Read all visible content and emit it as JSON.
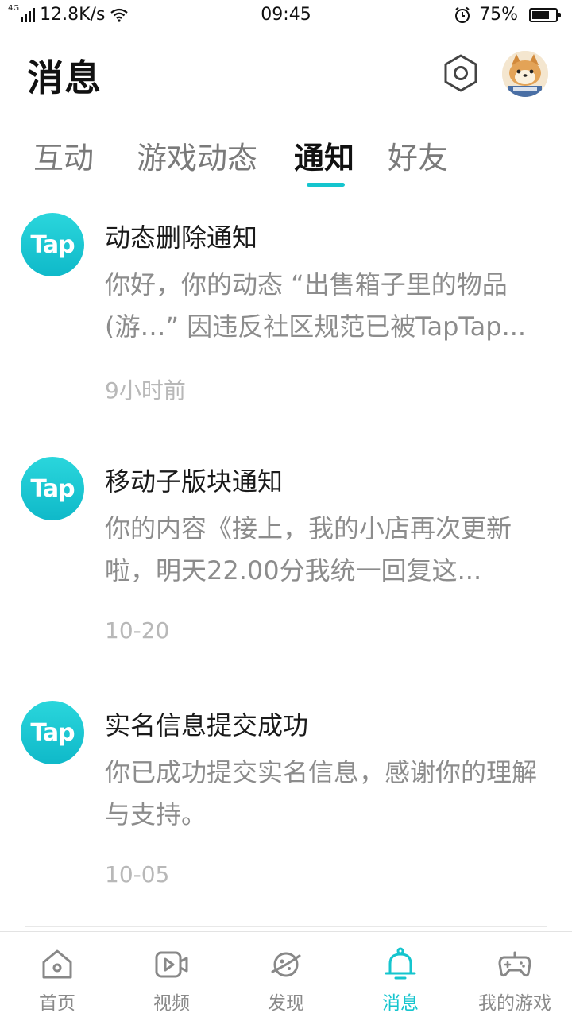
{
  "status_bar": {
    "network_type": "4G",
    "speed": "12.8K/s",
    "time": "09:45",
    "battery": "75%",
    "battery_level": 0.75
  },
  "header": {
    "title": "消息",
    "settings_icon": "gear-hexagon-icon",
    "avatar_icon": "avatar-image"
  },
  "tabs": [
    {
      "label": "互动",
      "active": false
    },
    {
      "label": "游戏动态",
      "active": false
    },
    {
      "label": "通知",
      "active": true
    },
    {
      "label": "好友",
      "active": false
    }
  ],
  "notifications": [
    {
      "logo_text": "Tap",
      "title": "动态删除通知",
      "body": "你好，你的动态 “出售箱子里的物品(游…” 因违反社区规范已被TapTap...",
      "time": "9小时前"
    },
    {
      "logo_text": "Tap",
      "title": "移动子版块通知",
      "body": "你的内容《接上，我的小店再次更新啦，明天22.00分我统一回复这...",
      "time": "10-20"
    },
    {
      "logo_text": "Tap",
      "title": "实名信息提交成功",
      "body": "你已成功提交实名信息，感谢你的理解与支持。",
      "time": "10-05"
    }
  ],
  "bottom_nav": [
    {
      "label": "首页",
      "icon": "home-icon",
      "active": false
    },
    {
      "label": "视频",
      "icon": "video-icon",
      "active": false
    },
    {
      "label": "发现",
      "icon": "planet-icon",
      "active": false
    },
    {
      "label": "消息",
      "icon": "bell-icon",
      "active": true
    },
    {
      "label": "我的游戏",
      "icon": "gamepad-icon",
      "active": false
    }
  ],
  "colors": {
    "accent": "#15c5ce",
    "text_primary": "#1a1a1a",
    "text_secondary": "#8c8c8c",
    "text_muted": "#b8b8b8"
  }
}
